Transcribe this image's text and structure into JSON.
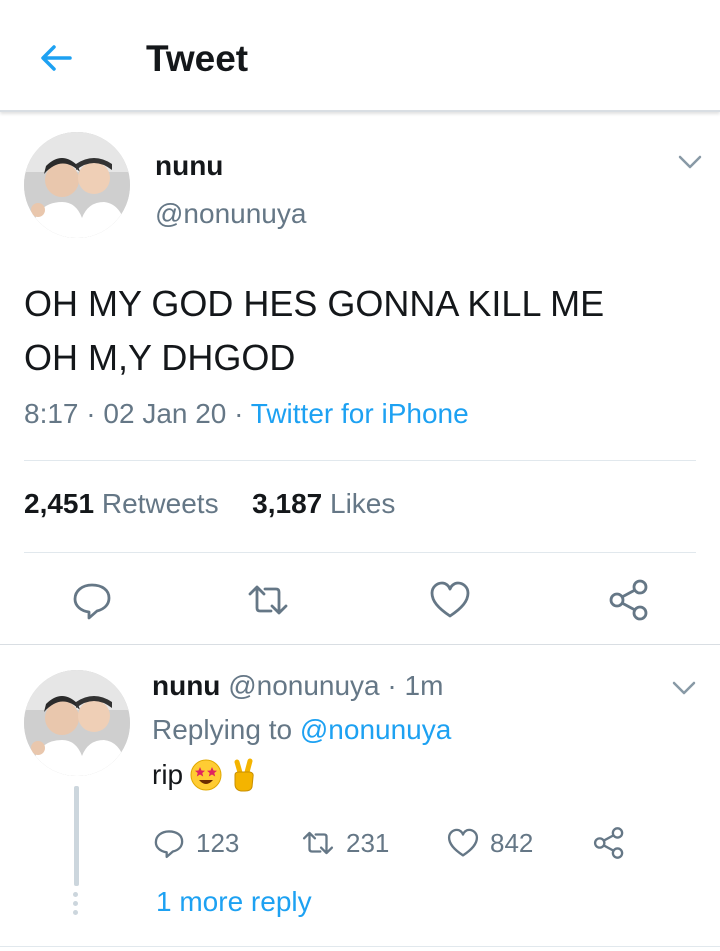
{
  "header": {
    "title": "Tweet"
  },
  "tweet": {
    "display_name": "nunu",
    "handle": "@nonunuya",
    "text_line1": "OH MY GOD HES GONNA KILL ME",
    "text_line2": "OH M,Y DHGOD",
    "time": "8:17",
    "date": "02 Jan 20",
    "source": "Twitter for iPhone",
    "retweet_count": "2,451",
    "retweet_label": "Retweets",
    "like_count": "3,187",
    "like_label": "Likes"
  },
  "reply": {
    "display_name": "nunu",
    "handle": "@nonunuya",
    "age": "1m",
    "replying_label": "Replying to",
    "replying_handle": "@nonunuya",
    "text": "rip",
    "emojis": [
      "star-struck-emoji",
      "victory-hand-emoji"
    ],
    "reply_count": "123",
    "retweet_count": "231",
    "like_count": "842",
    "more_replies": "1 more reply"
  },
  "colors": {
    "accent": "#1da1f2",
    "muted": "#657786",
    "divider": "#e1e8ed",
    "text": "#14171a"
  },
  "icons": [
    "back-arrow-icon",
    "chevron-down-icon",
    "reply-icon",
    "retweet-icon",
    "like-icon",
    "share-icon"
  ]
}
